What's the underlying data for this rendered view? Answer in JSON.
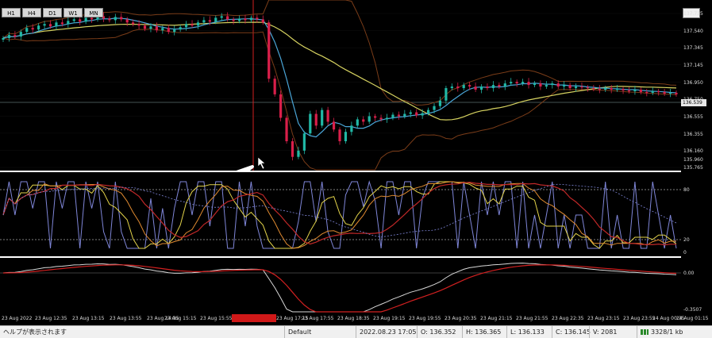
{
  "timeframes": [
    "H1",
    "H4",
    "D1",
    "W1",
    "MN"
  ],
  "price_axis": [
    "137.735",
    "137.540",
    "137.345",
    "137.145",
    "136.950",
    "136.750",
    "136.555",
    "136.355",
    "136.160",
    "135.960",
    "135.765"
  ],
  "current_price_tag": "136.539",
  "oscillator_axis": [
    "80",
    "20",
    "0"
  ],
  "macd_axis": [
    "0.00",
    "-0.3507"
  ],
  "time_axis": [
    "23 Aug 2022",
    "23 Aug 12:35",
    "23 Aug 13:15",
    "23 Aug 13:55",
    "23 Aug 14:35",
    "23 Aug 15:15",
    "23 Aug 15:55",
    "23 Aug 17:15",
    "23 Aug 17:55",
    "23 Aug 18:35",
    "23 Aug 19:15",
    "23 Aug 19:55",
    "23 Aug 20:35",
    "23 Aug 21:15",
    "23 Aug 21:55",
    "23 Aug 22:35",
    "23 Aug 23:15",
    "23 Aug 23:55",
    "24 Aug 00:35",
    "24 Aug 01:15"
  ],
  "status_bar": {
    "help_text": "ヘルプが表示されます",
    "profile": "Default",
    "datetime": "2022.08.23 17:05",
    "open": "O: 136.352",
    "high": "H: 136.365",
    "low": "L: 136.133",
    "close": "C: 136.145",
    "volume": "V: 2081",
    "traffic": "3328/1 kb"
  },
  "colors": {
    "bull": "#21b8a6",
    "bear": "#d91f4a",
    "band": "#7a3c18",
    "ma_slow": "#d6d260",
    "ma_fast": "#4aa6d8",
    "marker": "#d22020"
  },
  "chart_data": {
    "type": "candlestick",
    "ylim": [
      135.765,
      137.735
    ],
    "closes": [
      137.42,
      137.46,
      137.44,
      137.5,
      137.55,
      137.53,
      137.58,
      137.6,
      137.57,
      137.62,
      137.6,
      137.64,
      137.66,
      137.63,
      137.68,
      137.66,
      137.7,
      137.67,
      137.65,
      137.69,
      137.66,
      137.62,
      137.6,
      137.58,
      137.54,
      137.57,
      137.52,
      137.55,
      137.5,
      137.53,
      137.56,
      137.6,
      137.58,
      137.62,
      137.65,
      137.63,
      137.68,
      137.7,
      137.66,
      137.64,
      137.67,
      137.65,
      137.68,
      137.66,
      137.62,
      136.9,
      136.7,
      136.4,
      136.1,
      135.9,
      135.98,
      136.2,
      136.45,
      136.3,
      136.5,
      136.35,
      136.25,
      136.1,
      136.22,
      136.3,
      136.38,
      136.35,
      136.42,
      136.4,
      136.38,
      136.4,
      136.44,
      136.42,
      136.45,
      136.47,
      136.43,
      136.46,
      136.5,
      136.55,
      136.62,
      136.78,
      136.8,
      136.78,
      136.82,
      136.8,
      136.76,
      136.8,
      136.78,
      136.82,
      136.8,
      136.84,
      136.86,
      136.84,
      136.86,
      136.82,
      136.84,
      136.8,
      136.82,
      136.84,
      136.8,
      136.82,
      136.78,
      136.8,
      136.79,
      136.78,
      136.77,
      136.76,
      136.78,
      136.76,
      136.77,
      136.75,
      136.74,
      136.76,
      136.73,
      136.72,
      136.74,
      136.73,
      136.71,
      136.72,
      136.7
    ]
  }
}
